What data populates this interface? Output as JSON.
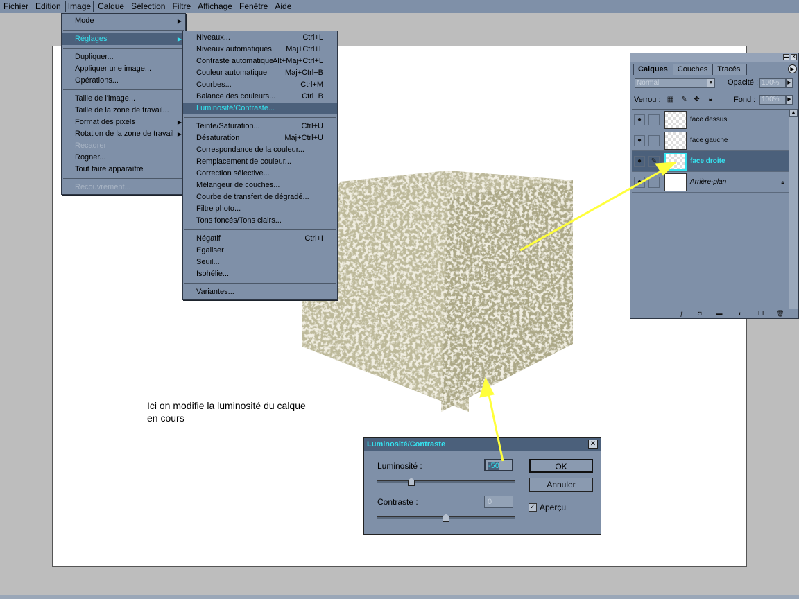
{
  "menubar": {
    "items": [
      "Fichier",
      "Edition",
      "Image",
      "Calque",
      "Sélection",
      "Filtre",
      "Affichage",
      "Fenêtre",
      "Aide"
    ],
    "active_index": 2
  },
  "image_menu": {
    "items": [
      {
        "label": "Mode",
        "submenu": true
      },
      {
        "sep": true
      },
      {
        "label": "Réglages",
        "submenu": true,
        "selected": true
      },
      {
        "sep": true
      },
      {
        "label": "Dupliquer..."
      },
      {
        "label": "Appliquer une image..."
      },
      {
        "label": "Opérations..."
      },
      {
        "sep": true
      },
      {
        "label": "Taille de l'image..."
      },
      {
        "label": "Taille de la zone de travail..."
      },
      {
        "label": "Format des pixels",
        "submenu": true
      },
      {
        "label": "Rotation de la zone de travail",
        "submenu": true
      },
      {
        "label": "Recadrer",
        "disabled": true
      },
      {
        "label": "Rogner..."
      },
      {
        "label": "Tout faire apparaître"
      },
      {
        "sep": true
      },
      {
        "label": "Recouvrement...",
        "disabled": true
      }
    ]
  },
  "reglages_menu": {
    "items": [
      {
        "label": "Niveaux...",
        "shortcut": "Ctrl+L"
      },
      {
        "label": "Niveaux automatiques",
        "shortcut": "Maj+Ctrl+L"
      },
      {
        "label": "Contraste automatique",
        "shortcut": "Alt+Maj+Ctrl+L"
      },
      {
        "label": "Couleur automatique",
        "shortcut": "Maj+Ctrl+B"
      },
      {
        "label": "Courbes...",
        "shortcut": "Ctrl+M"
      },
      {
        "label": "Balance des couleurs...",
        "shortcut": "Ctrl+B"
      },
      {
        "label": "Luminosité/Contraste...",
        "shortcut": "",
        "selected": true
      },
      {
        "sep": true
      },
      {
        "label": "Teinte/Saturation...",
        "shortcut": "Ctrl+U"
      },
      {
        "label": "Désaturation",
        "shortcut": "Maj+Ctrl+U"
      },
      {
        "label": "Correspondance de la couleur...",
        "shortcut": ""
      },
      {
        "label": "Remplacement de couleur...",
        "shortcut": ""
      },
      {
        "label": "Correction sélective...",
        "shortcut": ""
      },
      {
        "label": "Mélangeur de couches...",
        "shortcut": ""
      },
      {
        "label": "Courbe de transfert de dégradé...",
        "shortcut": ""
      },
      {
        "label": "Filtre photo...",
        "shortcut": ""
      },
      {
        "label": "Tons foncés/Tons clairs...",
        "shortcut": ""
      },
      {
        "sep": true
      },
      {
        "label": "Négatif",
        "shortcut": "Ctrl+I"
      },
      {
        "label": "Egaliser",
        "shortcut": ""
      },
      {
        "label": "Seuil...",
        "shortcut": ""
      },
      {
        "label": "Isohélie...",
        "shortcut": ""
      },
      {
        "sep": true
      },
      {
        "label": "Variantes...",
        "shortcut": ""
      }
    ]
  },
  "caption": {
    "line1": "Ici on modifie la luminosité du calque",
    "line2": "en cours"
  },
  "layers_panel": {
    "tabs": [
      "Calques",
      "Couches",
      "Tracés"
    ],
    "blend_mode": "Normal",
    "opacity_label": "Opacité :",
    "opacity_value": "100%",
    "lock_label": "Verrou :",
    "fill_label": "Fond :",
    "fill_value": "100%",
    "layers": [
      {
        "name": "face dessus",
        "visible": true,
        "selected": false
      },
      {
        "name": "face gauche",
        "visible": true,
        "selected": false
      },
      {
        "name": "face droite",
        "visible": true,
        "selected": true
      },
      {
        "name": "Arrière-plan",
        "visible": true,
        "selected": false,
        "background": true
      }
    ]
  },
  "dialog": {
    "title": "Luminosité/Contraste",
    "brightness_label": "Luminosité :",
    "brightness_value": "-50",
    "brightness_level": -50,
    "contrast_label": "Contraste :",
    "contrast_value": "0",
    "contrast_level": 0,
    "ok_label": "OK",
    "cancel_label": "Annuler",
    "preview_label": "Aperçu",
    "preview_checked": true
  },
  "colors": {
    "ui_bg": "#7f90a8",
    "highlight": "#4b607b",
    "highlight_text": "#35e3f0",
    "arrow": "#ffff3c"
  }
}
